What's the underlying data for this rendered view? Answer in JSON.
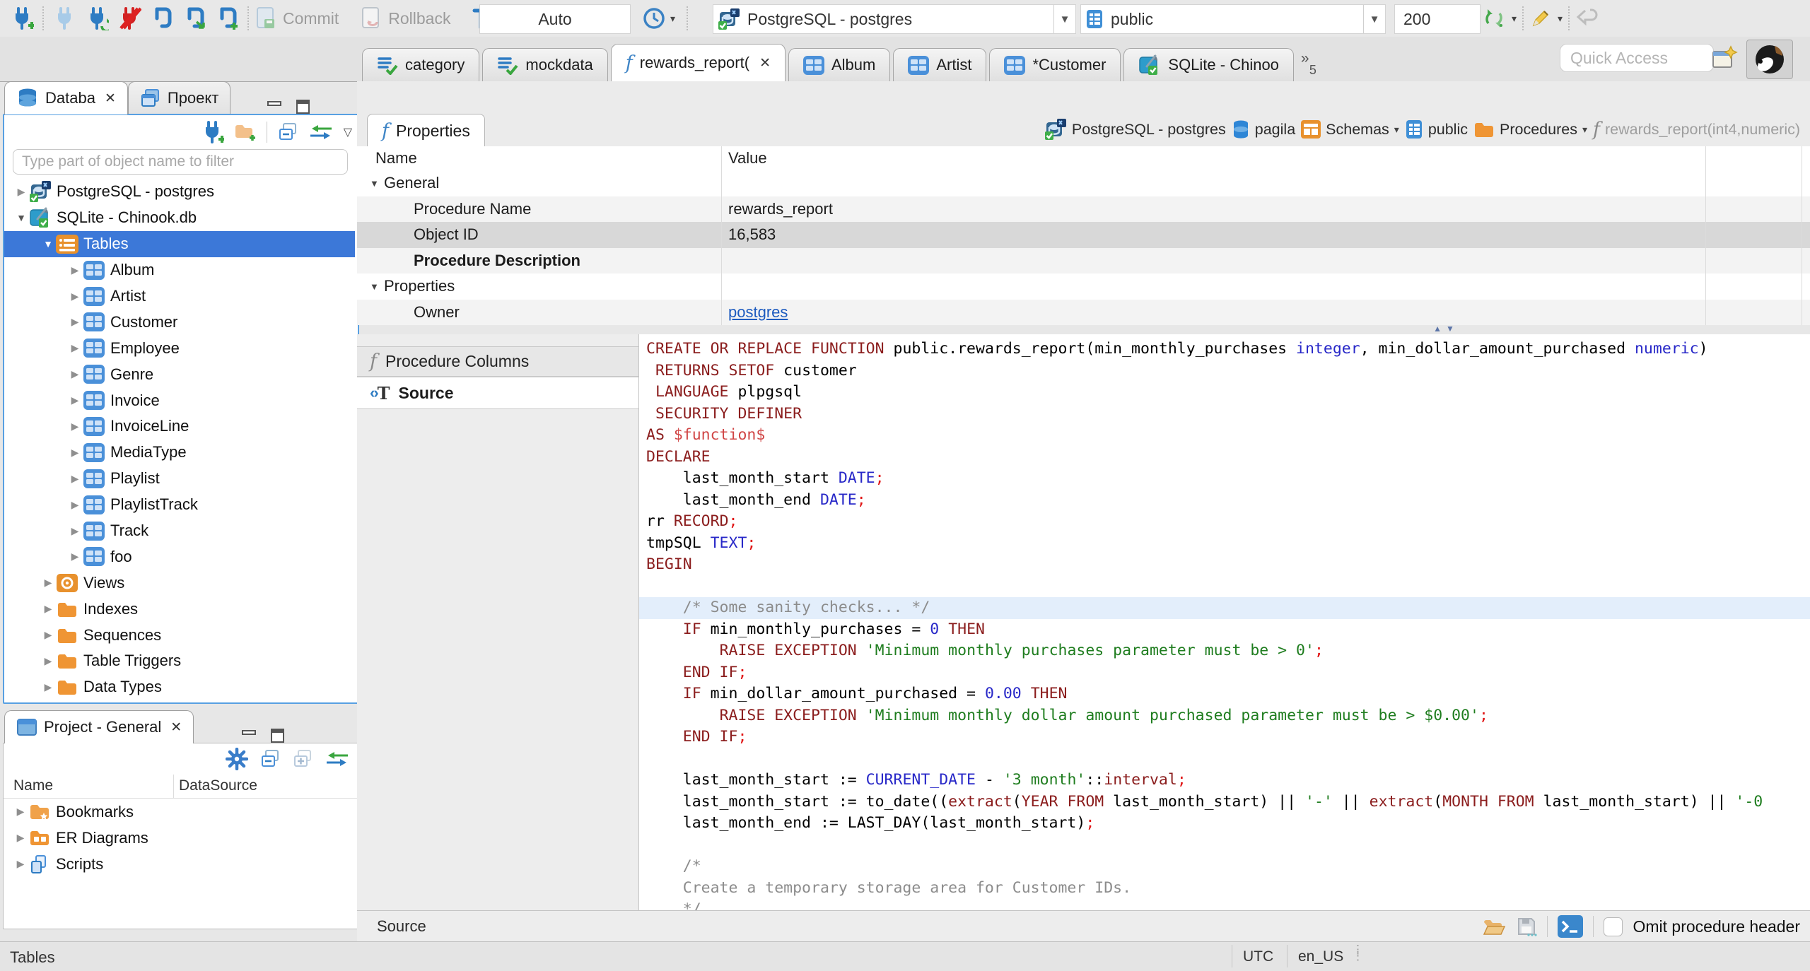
{
  "toolbar": {
    "commit_label": "Commit",
    "rollback_label": "Rollback",
    "autocommit_value": "Auto",
    "connection_value": "PostgreSQL - postgres",
    "schema_value": "public",
    "fetch_size_value": "200"
  },
  "quick_access_placeholder": "Quick Access",
  "editor_tabs": {
    "tabs": [
      {
        "label": "category",
        "icon": "script-check",
        "active": false,
        "closable": false
      },
      {
        "label": "mockdata",
        "icon": "script-check",
        "active": false,
        "closable": false
      },
      {
        "label": "rewards_report(",
        "icon": "function-blue",
        "active": true,
        "closable": true
      },
      {
        "label": "Album",
        "icon": "table",
        "active": false,
        "closable": false
      },
      {
        "label": "Artist",
        "icon": "table",
        "active": false,
        "closable": false
      },
      {
        "label": "*Customer",
        "icon": "table",
        "active": false,
        "closable": false
      },
      {
        "label": "SQLite - Chinoo",
        "icon": "sqlite",
        "active": false,
        "closable": false
      }
    ],
    "overflow_count": "5"
  },
  "navigator": {
    "tab_database": "Databa",
    "tab_projects": "Проект",
    "filter_placeholder": "Type part of object name to filter",
    "tree": [
      {
        "label": "PostgreSQL - postgres",
        "level": 0,
        "state": "collapsed",
        "icon": "postgres",
        "selected": false
      },
      {
        "label": "SQLite - Chinook.db",
        "level": 0,
        "state": "expanded",
        "icon": "sqlite",
        "selected": false
      },
      {
        "label": "Tables",
        "level": 1,
        "state": "expanded",
        "icon": "table-folder",
        "selected": true
      },
      {
        "label": "Album",
        "level": 2,
        "state": "collapsed",
        "icon": "table",
        "selected": false
      },
      {
        "label": "Artist",
        "level": 2,
        "state": "collapsed",
        "icon": "table",
        "selected": false
      },
      {
        "label": "Customer",
        "level": 2,
        "state": "collapsed",
        "icon": "table",
        "selected": false
      },
      {
        "label": "Employee",
        "level": 2,
        "state": "collapsed",
        "icon": "table",
        "selected": false
      },
      {
        "label": "Genre",
        "level": 2,
        "state": "collapsed",
        "icon": "table",
        "selected": false
      },
      {
        "label": "Invoice",
        "level": 2,
        "state": "collapsed",
        "icon": "table",
        "selected": false
      },
      {
        "label": "InvoiceLine",
        "level": 2,
        "state": "collapsed",
        "icon": "table",
        "selected": false
      },
      {
        "label": "MediaType",
        "level": 2,
        "state": "collapsed",
        "icon": "table",
        "selected": false
      },
      {
        "label": "Playlist",
        "level": 2,
        "state": "collapsed",
        "icon": "table",
        "selected": false
      },
      {
        "label": "PlaylistTrack",
        "level": 2,
        "state": "collapsed",
        "icon": "table",
        "selected": false
      },
      {
        "label": "Track",
        "level": 2,
        "state": "collapsed",
        "icon": "table",
        "selected": false
      },
      {
        "label": "foo",
        "level": 2,
        "state": "collapsed",
        "icon": "table",
        "selected": false
      },
      {
        "label": "Views",
        "level": 1,
        "state": "collapsed",
        "icon": "views",
        "selected": false
      },
      {
        "label": "Indexes",
        "level": 1,
        "state": "collapsed",
        "icon": "folder",
        "selected": false
      },
      {
        "label": "Sequences",
        "level": 1,
        "state": "collapsed",
        "icon": "folder",
        "selected": false
      },
      {
        "label": "Table Triggers",
        "level": 1,
        "state": "collapsed",
        "icon": "folder",
        "selected": false
      },
      {
        "label": "Data Types",
        "level": 1,
        "state": "collapsed",
        "icon": "folder",
        "selected": false
      }
    ]
  },
  "project_panel": {
    "title": "Project - General",
    "columns": [
      "Name",
      "DataSource"
    ],
    "tree": [
      {
        "label": "Bookmarks",
        "icon": "folder-star"
      },
      {
        "label": "ER Diagrams",
        "icon": "folder-diagram"
      },
      {
        "label": "Scripts",
        "icon": "scripts"
      }
    ]
  },
  "properties_view": {
    "tab_label": "Properties",
    "breadcrumb": [
      {
        "label": "PostgreSQL - postgres",
        "icon": "postgres",
        "dropdown": false,
        "muted": false
      },
      {
        "label": "pagila",
        "icon": "database",
        "dropdown": false,
        "muted": false
      },
      {
        "label": "Schemas",
        "icon": "schemas",
        "dropdown": true,
        "muted": false
      },
      {
        "label": "public",
        "icon": "schema-public",
        "dropdown": false,
        "muted": false
      },
      {
        "label": "Procedures",
        "icon": "folder",
        "dropdown": true,
        "muted": false
      },
      {
        "label": "rewards_report(int4,numeric)",
        "icon": "function-gray",
        "dropdown": false,
        "muted": true
      }
    ],
    "grid_columns": [
      "Name",
      "Value"
    ],
    "grid_rows": [
      {
        "name": "General",
        "value": "",
        "type": "group",
        "selected": false,
        "bold": false,
        "link": false
      },
      {
        "name": "Procedure Name",
        "value": "rewards_report",
        "type": "item",
        "selected": false,
        "bold": false,
        "link": false
      },
      {
        "name": "Object ID",
        "value": "16,583",
        "type": "item",
        "selected": true,
        "bold": false,
        "link": false
      },
      {
        "name": "Procedure Description",
        "value": "",
        "type": "item",
        "selected": false,
        "bold": true,
        "link": false
      },
      {
        "name": "Properties",
        "value": "",
        "type": "group",
        "selected": false,
        "bold": false,
        "link": false
      },
      {
        "name": "Owner",
        "value": "postgres",
        "type": "item",
        "selected": false,
        "bold": false,
        "link": true
      }
    ],
    "subtabs": [
      {
        "label": "Procedure Columns",
        "icon": "function-gray",
        "active": false
      },
      {
        "label": "Source",
        "icon": "source-text",
        "active": true
      }
    ],
    "bottom_left_label": "Source",
    "omit_header_label": "Omit procedure header"
  },
  "source_editor": {
    "highlight_line_index": 12,
    "lines": [
      [
        [
          "kw",
          "CREATE OR REPLACE FUNCTION "
        ],
        [
          "pl",
          "public.rewards_report(min_monthly_purchases "
        ],
        [
          "ty",
          "integer"
        ],
        [
          "pl",
          ", min_dollar_amount_purchased "
        ],
        [
          "ty",
          "numeric"
        ],
        [
          "pl",
          ")"
        ]
      ],
      [
        [
          "pl",
          " "
        ],
        [
          "kw",
          "RETURNS SETOF"
        ],
        [
          "pl",
          " customer"
        ]
      ],
      [
        [
          "pl",
          " "
        ],
        [
          "kw",
          "LANGUAGE"
        ],
        [
          "pl",
          " plpgsql"
        ]
      ],
      [
        [
          "pl",
          " "
        ],
        [
          "kw",
          "SECURITY DEFINER"
        ]
      ],
      [
        [
          "kw",
          "AS "
        ],
        [
          "dl",
          "$function$"
        ]
      ],
      [
        [
          "kw",
          "DECLARE"
        ]
      ],
      [
        [
          "pl",
          "    last_month_start "
        ],
        [
          "ty",
          "DATE"
        ],
        [
          "sc",
          ";"
        ]
      ],
      [
        [
          "pl",
          "    last_month_end "
        ],
        [
          "ty",
          "DATE"
        ],
        [
          "sc",
          ";"
        ]
      ],
      [
        [
          "pl",
          "rr "
        ],
        [
          "kw",
          "RECORD"
        ],
        [
          "sc",
          ";"
        ]
      ],
      [
        [
          "pl",
          "tmpSQL "
        ],
        [
          "ty",
          "TEXT"
        ],
        [
          "sc",
          ";"
        ]
      ],
      [
        [
          "kw",
          "BEGIN"
        ]
      ],
      [],
      [
        [
          "cm",
          "    /* Some sanity checks... */"
        ]
      ],
      [
        [
          "pl",
          "    "
        ],
        [
          "kw",
          "IF"
        ],
        [
          "pl",
          " min_monthly_purchases = "
        ],
        [
          "nu",
          "0"
        ],
        [
          "pl",
          " "
        ],
        [
          "kw",
          "THEN"
        ]
      ],
      [
        [
          "pl",
          "        "
        ],
        [
          "kw",
          "RAISE EXCEPTION"
        ],
        [
          "pl",
          " "
        ],
        [
          "st",
          "'Minimum monthly purchases parameter must be > 0'"
        ],
        [
          "sc",
          ";"
        ]
      ],
      [
        [
          "pl",
          "    "
        ],
        [
          "kw",
          "END IF"
        ],
        [
          "sc",
          ";"
        ]
      ],
      [
        [
          "pl",
          "    "
        ],
        [
          "kw",
          "IF"
        ],
        [
          "pl",
          " min_dollar_amount_purchased = "
        ],
        [
          "nu",
          "0.00"
        ],
        [
          "pl",
          " "
        ],
        [
          "kw",
          "THEN"
        ]
      ],
      [
        [
          "pl",
          "        "
        ],
        [
          "kw",
          "RAISE EXCEPTION"
        ],
        [
          "pl",
          " "
        ],
        [
          "st",
          "'Minimum monthly dollar amount purchased parameter must be > $0.00'"
        ],
        [
          "sc",
          ";"
        ]
      ],
      [
        [
          "pl",
          "    "
        ],
        [
          "kw",
          "END IF"
        ],
        [
          "sc",
          ";"
        ]
      ],
      [],
      [
        [
          "pl",
          "    last_month_start := "
        ],
        [
          "ty",
          "CURRENT_DATE"
        ],
        [
          "pl",
          " - "
        ],
        [
          "st",
          "'3 month'"
        ],
        [
          "pl",
          "::"
        ],
        [
          "kw",
          "interval"
        ],
        [
          "sc",
          ";"
        ]
      ],
      [
        [
          "pl",
          "    last_month_start := to_date(("
        ],
        [
          "kw",
          "extract"
        ],
        [
          "pl",
          "("
        ],
        [
          "kw",
          "YEAR FROM"
        ],
        [
          "pl",
          " last_month_start) || "
        ],
        [
          "st",
          "'-'"
        ],
        [
          "pl",
          " || "
        ],
        [
          "kw",
          "extract"
        ],
        [
          "pl",
          "("
        ],
        [
          "kw",
          "MONTH FROM"
        ],
        [
          "pl",
          " last_month_start) || "
        ],
        [
          "st",
          "'-0"
        ]
      ],
      [
        [
          "pl",
          "    last_month_end := LAST_DAY(last_month_start)"
        ],
        [
          "sc",
          ";"
        ]
      ],
      [],
      [
        [
          "cm",
          "    /*"
        ]
      ],
      [
        [
          "cm",
          "    Create a temporary storage area for Customer IDs."
        ]
      ],
      [
        [
          "cm",
          "    */"
        ]
      ]
    ]
  },
  "status_bar": {
    "context": "Tables",
    "timezone": "UTC",
    "locale": "en_US"
  }
}
